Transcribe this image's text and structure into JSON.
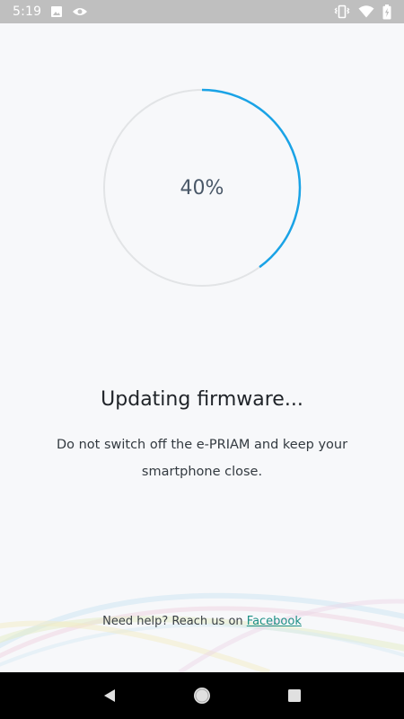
{
  "status_bar": {
    "time": "5:19",
    "icons_left": [
      "image-icon",
      "eye-icon"
    ],
    "icons_right": [
      "vibrate-icon",
      "wifi-icon",
      "battery-charging-icon"
    ]
  },
  "progress": {
    "label": "40%",
    "value": 0.4,
    "track_color": "#e2e4e6",
    "fill_color": "#1aa3e6"
  },
  "title": "Updating firmware...",
  "subtitle_lines": [
    "Do not switch off the e-PRIAM and keep your",
    "smartphone close."
  ],
  "help": {
    "prefix": "Need help? Reach us on",
    "link_label": "Facebook",
    "link_color": "#1e8f85"
  },
  "nav_bar": {
    "buttons": [
      "back-icon",
      "home-icon",
      "recents-icon"
    ]
  }
}
